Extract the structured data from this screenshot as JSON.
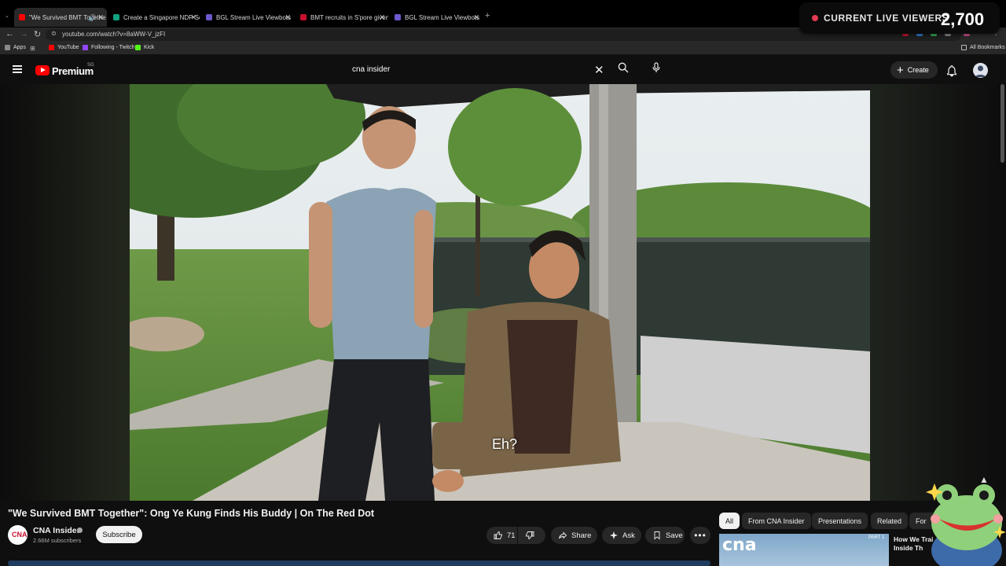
{
  "browser": {
    "tabs": [
      {
        "title": "\"We Survived BMT Togethe",
        "favicon_color": "#ff0000",
        "active": true
      },
      {
        "title": "Create a Singapore NDP Song",
        "favicon_color": "#10a37f",
        "active": false
      },
      {
        "title": "BGL Stream Live Viewbots",
        "favicon_color": "#6a5acd",
        "active": false
      },
      {
        "title": "BMT recruits in S'pore given m",
        "favicon_color": "#c8102e",
        "active": false
      },
      {
        "title": "BGL Stream Live Viewbots",
        "favicon_color": "#6a5acd",
        "active": false
      }
    ],
    "url": "youtube.com/watch?v=8aWW-V_jzFI",
    "bookmarks": [
      {
        "label": "Apps",
        "icon": "apps-grid-icon"
      },
      {
        "label": "YouTube",
        "icon": "youtube-icon"
      },
      {
        "label": "Following - Twitch",
        "icon": "twitch-icon"
      },
      {
        "label": "Kick",
        "icon": "kick-icon"
      }
    ],
    "all_bookmarks": "All Bookmarks"
  },
  "overlay": {
    "label": "CURRENT LIVE VIEWERS",
    "count": "2,700"
  },
  "header": {
    "brand": "Premium",
    "country": "SG",
    "search_value": "cna insider",
    "create_label": "Create"
  },
  "video": {
    "subtitle": "Eh?",
    "title": "\"We Survived BMT Together\": Ong Ye Kung Finds His Buddy | On The Red Dot"
  },
  "channel": {
    "name": "CNA Insider",
    "subscribers": "2.66M subscribers",
    "subscribe_label": "Subscribe",
    "avatar_text": "CNA"
  },
  "actions": {
    "likes": "71",
    "share": "Share",
    "ask": "Ask",
    "save": "Save"
  },
  "chips": [
    "All",
    "From CNA Insider",
    "Presentations",
    "Related",
    "For"
  ],
  "recommendation": {
    "thumb_text": "cna",
    "part_label": "PART 1",
    "title": "How We Trai Inside Th"
  },
  "colors": {
    "youtube_red": "#ff0000",
    "live_dot": "#e33b52",
    "progress_bar": "#1f3b5e"
  }
}
